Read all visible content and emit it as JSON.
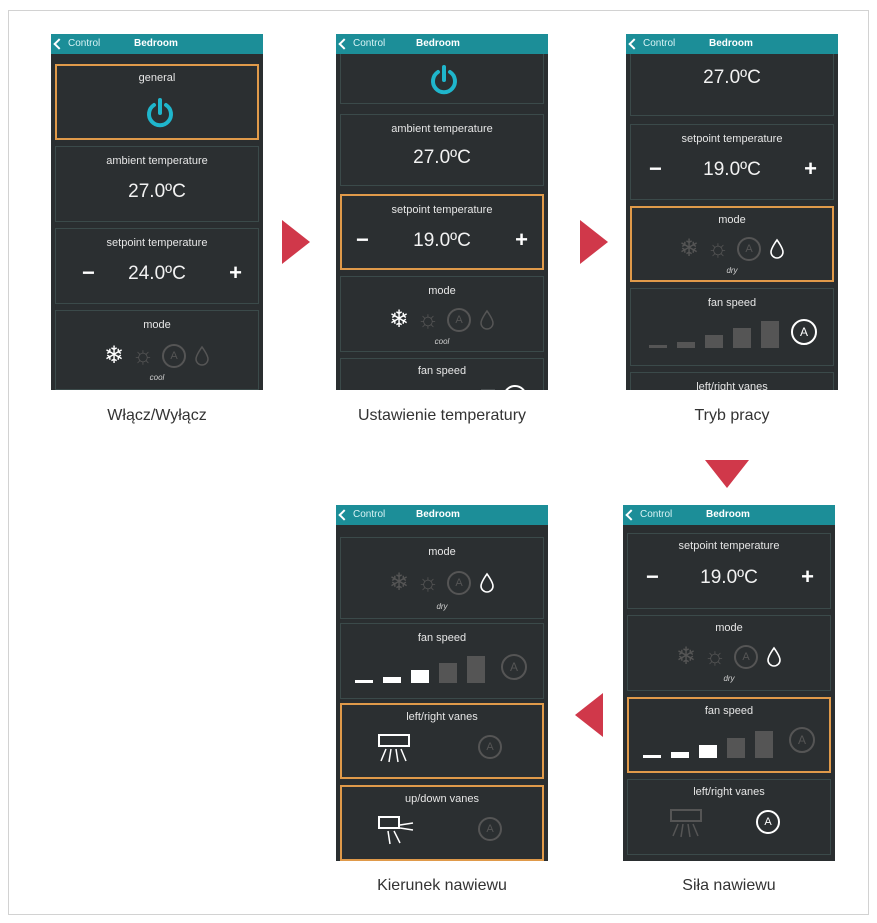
{
  "colors": {
    "accent": "#1c8e98",
    "highlight": "#e09a4a",
    "arrow": "#d0384a",
    "panel": "#2b2f31"
  },
  "screens": [
    {
      "caption": "Włącz/Wyłącz",
      "back": "Control",
      "room": "Bedroom",
      "general_label": "general",
      "ambient_label": "ambient temperature",
      "ambient_value": "27.0ºC",
      "setpoint_label": "setpoint temperature",
      "setpoint_value": "24.0ºC",
      "minus": "−",
      "plus": "+",
      "mode_label": "mode",
      "mode_value": "cool"
    },
    {
      "caption": "Ustawienie temperatury",
      "back": "Control",
      "room": "Bedroom",
      "ambient_label": "ambient temperature",
      "ambient_value": "27.0ºC",
      "setpoint_label": "setpoint temperature",
      "setpoint_value": "19.0ºC",
      "minus": "−",
      "plus": "+",
      "mode_label": "mode",
      "mode_value": "cool",
      "fan_label": "fan speed"
    },
    {
      "caption": "Tryb pracy",
      "back": "Control",
      "room": "Bedroom",
      "ambient_value": "27.0ºC",
      "setpoint_label": "setpoint temperature",
      "setpoint_value": "19.0ºC",
      "minus": "−",
      "plus": "+",
      "mode_label": "mode",
      "mode_value": "dry",
      "fan_label": "fan speed",
      "lr_label": "left/right vanes"
    },
    {
      "caption": "Kierunek nawiewu",
      "back": "Control",
      "room": "Bedroom",
      "mode_label": "mode",
      "mode_value": "dry",
      "fan_label": "fan speed",
      "lr_label": "left/right vanes",
      "ud_label": "up/down vanes"
    },
    {
      "caption": "Siła nawiewu",
      "back": "Control",
      "room": "Bedroom",
      "setpoint_label": "setpoint temperature",
      "setpoint_value": "19.0ºC",
      "minus": "−",
      "plus": "+",
      "mode_label": "mode",
      "mode_value": "dry",
      "fan_label": "fan speed",
      "lr_label": "left/right vanes"
    }
  ]
}
